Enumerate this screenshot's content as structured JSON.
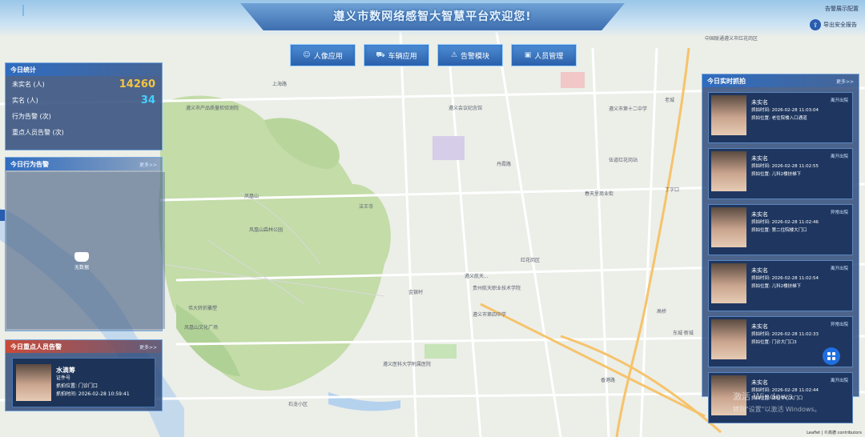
{
  "header": {
    "title": "遵义市数网络感智大智慧平台欢迎您!",
    "alarm_text": "告警展示配置",
    "export_label": "导出安全报告"
  },
  "nav": [
    {
      "label": "人像应用",
      "icon": "face-icon"
    },
    {
      "label": "车辆应用",
      "icon": "car-icon"
    },
    {
      "label": "告警模块",
      "icon": "alarm-icon"
    },
    {
      "label": "人员管理",
      "icon": "person-card-icon"
    }
  ],
  "stats": {
    "title": "今日统计",
    "rows": [
      {
        "label": "未实名 (人)",
        "value": "14260",
        "color": "#f5c542"
      },
      {
        "label": "实名 (人)",
        "value": "34",
        "color": "#44d0ff"
      },
      {
        "label": "行为告警 (次)",
        "value": "",
        "color": "#ff6b6b"
      },
      {
        "label": "重点人员告警 (次)",
        "value": "",
        "color": "#ff6b6b"
      }
    ]
  },
  "behavior": {
    "title": "今日行为告警",
    "more": "更多>>",
    "marker_label": "无数据"
  },
  "key_persons": {
    "title": "今日重点人员告警",
    "more": "更多>>",
    "card": {
      "name": "水滴筹",
      "id_label": "证件号",
      "location_label": "抓拍位置: 门诊门口",
      "time_label": "抓拍时间: 2026-02-28 10:59:41"
    }
  },
  "realtime": {
    "title": "今日实时抓拍",
    "more": "更多>>",
    "cards": [
      {
        "name": "未实名",
        "time": "抓拍时间: 2026-02-28 11:03:04",
        "location": "抓拍位置: 老住院楼入口通道",
        "tag": "离开出院"
      },
      {
        "name": "未实名",
        "time": "抓拍时间: 2026-02-28 11:02:55",
        "location": "抓拍位置: 儿科2楼扶梯下",
        "tag": "离开出院"
      },
      {
        "name": "未实名",
        "time": "抓拍时间: 2026-02-28 11:02:46",
        "location": "抓拍位置: 第二住院楼大门口",
        "tag": "异常出院"
      },
      {
        "name": "未实名",
        "time": "抓拍时间: 2026-02-28 11:02:54",
        "location": "抓拍位置: 儿科2楼扶梯下",
        "tag": "离开出院"
      },
      {
        "name": "未实名",
        "time": "抓拍时间: 2026-02-28 11:02:33",
        "location": "抓拍位置: 门诊大门口3",
        "tag": "异常出院"
      },
      {
        "name": "未实名",
        "time": "抓拍时间: 2026-02-28 11:02:44",
        "location": "抓拍位置: 体检中心大门口",
        "tag": "离开出院"
      }
    ]
  },
  "map_labels": [
    "遵义市产品质量检验测院",
    "上海路",
    "凤凰山",
    "风凰山森林公园",
    "法王寺",
    "凤凰山文化广场",
    "伟大转折雕塑",
    "遵义医科大学附属医院",
    "遵义航天...",
    "红花岗区",
    "春天里商业街",
    "伍道红花岗站",
    "老城",
    "中国联通遵义市红花岗区",
    "丁字口",
    "遵义市第十二中学",
    "贵州航天职业技术学院",
    "金银村",
    "丹霞路",
    "遵义市第四中学",
    "遵义会议纪念馆",
    "高桥",
    "东城·新城",
    "石龙小区",
    "香港路"
  ],
  "watermark": [
    "激活 Windows",
    "转到\"设置\"以激活 Windows。"
  ],
  "attribution": "Leaflet | ©高德 contributors"
}
